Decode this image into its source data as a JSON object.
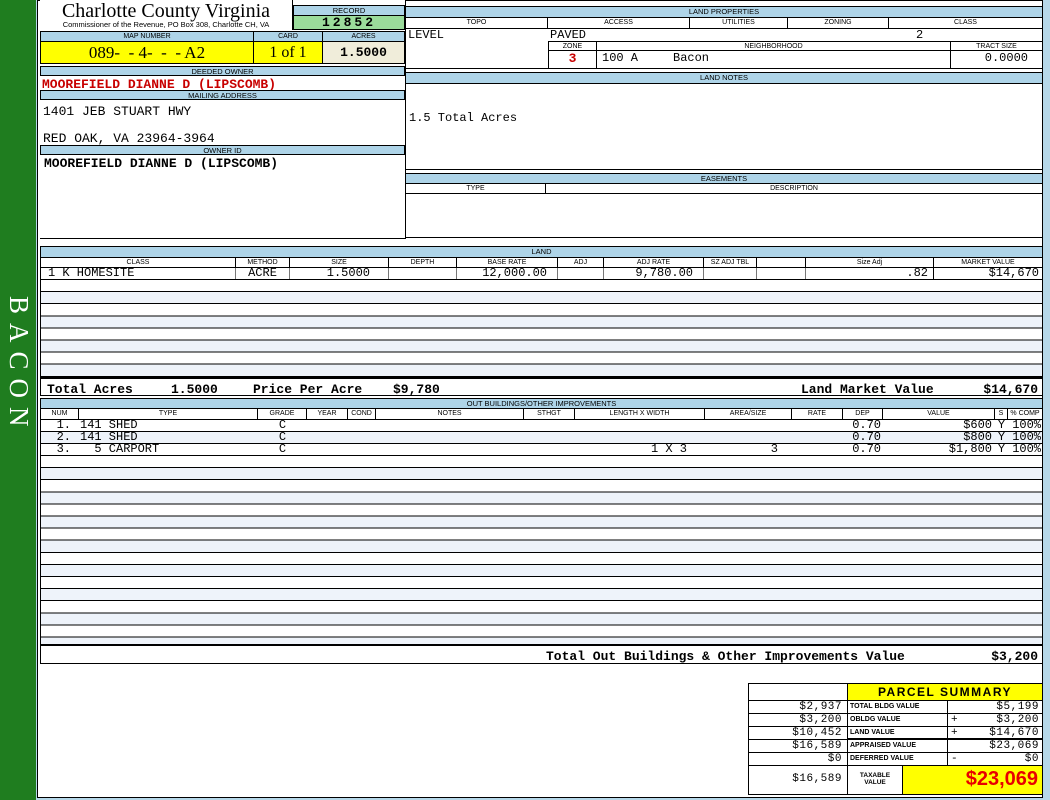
{
  "sidebar": {
    "district": "BACON"
  },
  "county": {
    "title": "Charlotte County Virginia",
    "subtitle": "Commissioner of the Revenue, PO Box 308, Charlotte CH, VA"
  },
  "record": {
    "label": "RECORD",
    "value": "12852"
  },
  "parcel_header": {
    "map_number_label": "MAP NUMBER",
    "map_number": "089-  - 4-  -  - A2",
    "card_label": "CARD",
    "card": "1 of 1",
    "acres_label": "ACRES",
    "acres": "1.5000"
  },
  "owner": {
    "deeded_owner_label": "DEEDED OWNER",
    "deeded_owner": "MOOREFIELD DIANNE D (LIPSCOMB)",
    "mailing_address_label": "MAILING ADDRESS",
    "address_line1": "1401 JEB STUART HWY",
    "address_line2": "RED OAK, VA 23964-3964",
    "owner_id_label": "OWNER ID",
    "owner_id": "MOOREFIELD DIANNE D (LIPSCOMB)"
  },
  "land_properties": {
    "title": "LAND PROPERTIES",
    "topo_label": "TOPO",
    "topo": "LEVEL",
    "access_label": "ACCESS",
    "access": "PAVED",
    "utilities_label": "UTILITIES",
    "utilities": "",
    "zoning_label": "ZONING",
    "zoning": "",
    "class_label": "CLASS",
    "class": "2",
    "zone_label": "ZONE",
    "zone": "3",
    "neighborhood_label": "NEIGHBORHOOD",
    "neighborhood_code": "100 A",
    "neighborhood_name": "Bacon",
    "tract_size_label": "TRACT SIZE",
    "tract_size": "0.0000"
  },
  "land_notes": {
    "title": "LAND NOTES",
    "note": "1.5 Total Acres"
  },
  "easements": {
    "title": "EASEMENTS",
    "type_label": "TYPE",
    "description_label": "DESCRIPTION"
  },
  "land": {
    "title": "LAND",
    "headers": [
      "CLASS",
      "METHOD",
      "SIZE",
      "DEPTH",
      "BASE RATE",
      "ADJ",
      "ADJ RATE",
      "SZ ADJ TBL",
      "",
      "Size Adj",
      "MARKET VALUE"
    ],
    "row": {
      "class": "1 K HOMESITE",
      "method": "ACRE",
      "size": "1.5000",
      "depth": "",
      "base_rate": "12,000.00",
      "adj": "",
      "adj_rate": "9,780.00",
      "sz_adj_tbl": "",
      "blank": "",
      "size_adj": ".82",
      "market_value": "$14,670"
    },
    "totals": {
      "total_acres_label": "Total Acres",
      "total_acres": "1.5000",
      "price_per_acre_label": "Price Per Acre",
      "price_per_acre": "$9,780",
      "market_value_label": "Land Market Value",
      "market_value": "$14,670"
    }
  },
  "out_buildings": {
    "title": "OUT BUILDINGS/OTHER IMPROVEMENTS",
    "headers": [
      "NUM",
      "TYPE",
      "GRADE",
      "YEAR",
      "COND",
      "NOTES",
      "STHGT",
      "LENGTH X WIDTH",
      "AREA/SIZE",
      "RATE",
      "DEP",
      "VALUE",
      "S",
      "% COMP"
    ],
    "rows": [
      {
        "num": "1.",
        "type": "141 SHED",
        "grade": "C",
        "year": "",
        "cond": "",
        "notes": "",
        "sthgt": "",
        "lxw": "",
        "area": "",
        "rate": "",
        "dep": "0.70",
        "value": "$600",
        "s": "Y",
        "comp": "100%"
      },
      {
        "num": "2.",
        "type": "141 SHED",
        "grade": "C",
        "year": "",
        "cond": "",
        "notes": "",
        "sthgt": "",
        "lxw": "",
        "area": "",
        "rate": "",
        "dep": "0.70",
        "value": "$800",
        "s": "Y",
        "comp": "100%"
      },
      {
        "num": "3.",
        "type": "  5 CARPORT",
        "grade": "C",
        "year": "",
        "cond": "",
        "notes": "",
        "sthgt": "",
        "lxw": "1 X 3",
        "area": "3",
        "rate": "",
        "dep": "0.70",
        "value": "$1,800",
        "s": "Y",
        "comp": "100%"
      }
    ],
    "total_label": "Total Out Buildings & Other Improvements Value",
    "total_value": "$3,200"
  },
  "parcel_summary": {
    "title": "PARCEL SUMMARY",
    "rows": [
      {
        "prior": "$2,937",
        "label": "TOTAL BLDG VALUE",
        "sign": "",
        "value": "$5,199"
      },
      {
        "prior": "$3,200",
        "label": "OBLDG VALUE",
        "sign": "+",
        "value": "$3,200"
      },
      {
        "prior": "$10,452",
        "label": "LAND VALUE",
        "sign": "+",
        "value": "$14,670"
      },
      {
        "prior": "$16,589",
        "label": "APPRAISED VALUE",
        "sign": "",
        "value": "$23,069"
      },
      {
        "prior": "$0",
        "label": "DEFERRED VALUE",
        "sign": "-",
        "value": "$0"
      }
    ],
    "taxable": {
      "prior": "$16,589",
      "label_line1": "TAXABLE",
      "label_line2": "VALUE",
      "value": "$23,069"
    }
  },
  "colors": {
    "header_blue": "#aed4e8",
    "highlight_yellow": "#ffff00",
    "sidebar_green": "#1f7d1f",
    "record_green": "#9bdc9b",
    "acres_ivory": "#f0edda",
    "owner_red": "#c80000",
    "taxable_red": "#e80000",
    "stripe_blue": "#eef3fa"
  }
}
